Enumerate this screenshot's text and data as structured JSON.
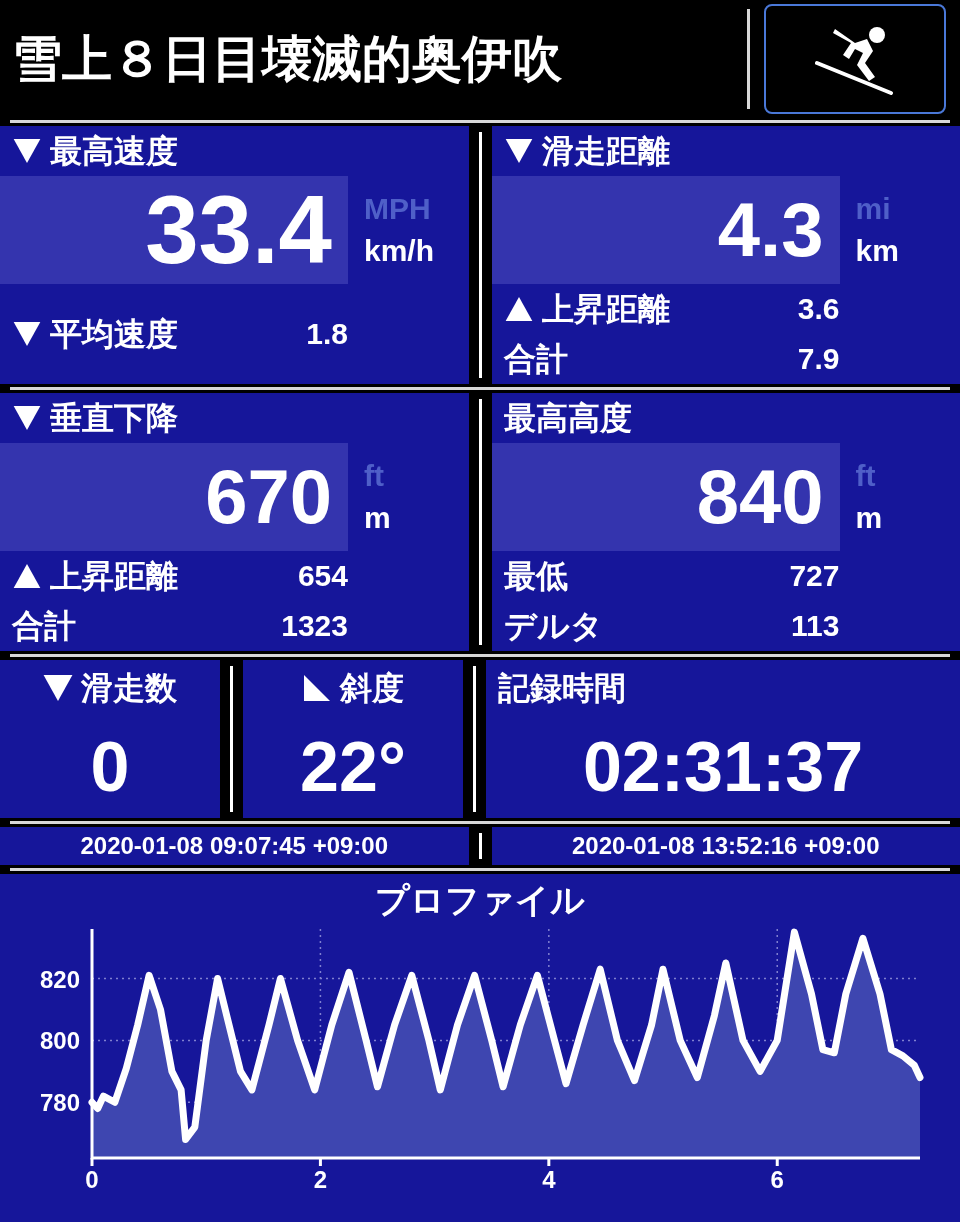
{
  "header": {
    "title": "雪上８日目壊滅的奥伊吹"
  },
  "metric_panels": [
    {
      "title": "最高速度",
      "kind": "down",
      "value": "33.4",
      "units": [
        {
          "label": "MPH",
          "selected": false
        },
        {
          "label": "km/h",
          "selected": true
        }
      ],
      "rows": [
        {
          "label": "平均速度",
          "kind": "down",
          "value": "1.8"
        }
      ]
    },
    {
      "title": "滑走距離",
      "kind": "down",
      "value": "4.3",
      "units": [
        {
          "label": "mi",
          "selected": false
        },
        {
          "label": "km",
          "selected": true
        }
      ],
      "rows": [
        {
          "label": "上昇距離",
          "kind": "up",
          "value": "3.6"
        },
        {
          "label": "合計",
          "value": "7.9"
        }
      ]
    },
    {
      "title": "垂直下降",
      "kind": "down",
      "value": "670",
      "units": [
        {
          "label": "ft",
          "selected": false
        },
        {
          "label": "m",
          "selected": true
        }
      ],
      "rows": [
        {
          "label": "上昇距離",
          "kind": "up",
          "value": "654"
        },
        {
          "label": "合計",
          "value": "1323"
        }
      ]
    },
    {
      "title": "最高高度",
      "value": "840",
      "units": [
        {
          "label": "ft",
          "selected": false
        },
        {
          "label": "m",
          "selected": true
        }
      ],
      "rows": [
        {
          "label": "最低",
          "value": "727"
        },
        {
          "label": "デルタ",
          "value": "113"
        }
      ]
    }
  ],
  "counter_panels": [
    {
      "title": "滑走数",
      "kind": "down",
      "value": "0"
    },
    {
      "title": "斜度",
      "kind": "slope",
      "value": "22°"
    },
    {
      "title": "記録時間",
      "value": "02:31:37"
    }
  ],
  "timestamps": [
    "2020-01-08 09:07:45 +09:00",
    "2020-01-08 13:52:16 +09:00"
  ],
  "profile": {
    "chart_data": {
      "type": "area",
      "title": "プロファイル",
      "xlim": [
        0,
        7.25
      ],
      "ylim": [
        762,
        836
      ],
      "xticks": [
        0,
        2,
        4,
        6
      ],
      "yticks": [
        780,
        800,
        820
      ],
      "grid": true,
      "x": [
        0,
        0.05,
        0.1,
        0.2,
        0.3,
        0.4,
        0.5,
        0.6,
        0.7,
        0.78,
        0.82,
        0.9,
        1.0,
        1.1,
        1.2,
        1.3,
        1.4,
        1.55,
        1.65,
        1.8,
        1.95,
        2.1,
        2.25,
        2.4,
        2.5,
        2.65,
        2.8,
        2.95,
        3.05,
        3.2,
        3.35,
        3.5,
        3.6,
        3.75,
        3.9,
        4.05,
        4.15,
        4.3,
        4.45,
        4.6,
        4.75,
        4.9,
        5.0,
        5.15,
        5.3,
        5.45,
        5.55,
        5.7,
        5.85,
        6.0,
        6.15,
        6.3,
        6.4,
        6.5,
        6.6,
        6.75,
        6.9,
        7.0,
        7.1,
        7.2,
        7.25
      ],
      "series": [
        {
          "color": "#ffffff",
          "values": [
            780,
            778,
            782,
            780,
            791,
            805,
            821,
            810,
            790,
            784,
            768,
            772,
            800,
            820,
            805,
            790,
            784,
            805,
            820,
            800,
            784,
            805,
            822,
            800,
            785,
            805,
            821,
            800,
            784,
            805,
            821,
            800,
            785,
            805,
            821,
            800,
            786,
            805,
            823,
            800,
            787,
            805,
            823,
            800,
            788,
            808,
            825,
            800,
            790,
            800,
            835,
            815,
            797,
            796,
            815,
            833,
            815,
            797,
            795,
            792,
            788
          ]
        }
      ]
    }
  }
}
